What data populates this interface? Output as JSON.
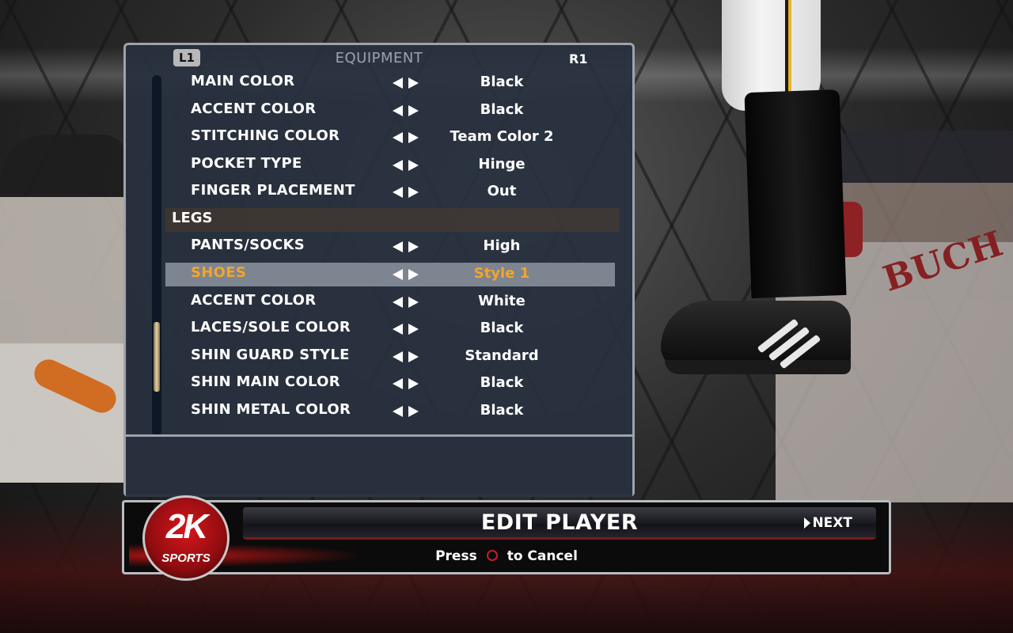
{
  "header": {
    "left_bumper": "L1",
    "right_bumper": "R1",
    "section_title": "EQUIPMENT"
  },
  "rows": [
    {
      "label": "MAIN COLOR",
      "value": "Black"
    },
    {
      "label": "ACCENT COLOR",
      "value": "Black"
    },
    {
      "label": "STITCHING COLOR",
      "value": "Team Color 2"
    },
    {
      "label": "POCKET TYPE",
      "value": "Hinge"
    },
    {
      "label": "FINGER PLACEMENT",
      "value": "Out"
    }
  ],
  "category": {
    "label": "LEGS"
  },
  "legs_rows": [
    {
      "label": "PANTS/SOCKS",
      "value": "High"
    },
    {
      "label": "SHOES",
      "value": "Style 1",
      "selected": true
    },
    {
      "label": "ACCENT COLOR",
      "value": "White"
    },
    {
      "label": "LACES/SOLE COLOR",
      "value": "Black"
    },
    {
      "label": "SHIN GUARD STYLE",
      "value": "Standard"
    },
    {
      "label": "SHIN MAIN COLOR",
      "value": "Black"
    },
    {
      "label": "SHIN METAL COLOR",
      "value": "Black"
    }
  ],
  "footer": {
    "title": "EDIT PLAYER",
    "next_label": "NEXT",
    "cancel_press": "Press",
    "cancel_action": "to Cancel"
  },
  "logo": {
    "brand": "2K",
    "subtext": "SPORTS"
  },
  "background": {
    "player_name": "BUCH"
  },
  "colors": {
    "selected_text": "#f2a52b",
    "accent_red": "#c2212b"
  }
}
